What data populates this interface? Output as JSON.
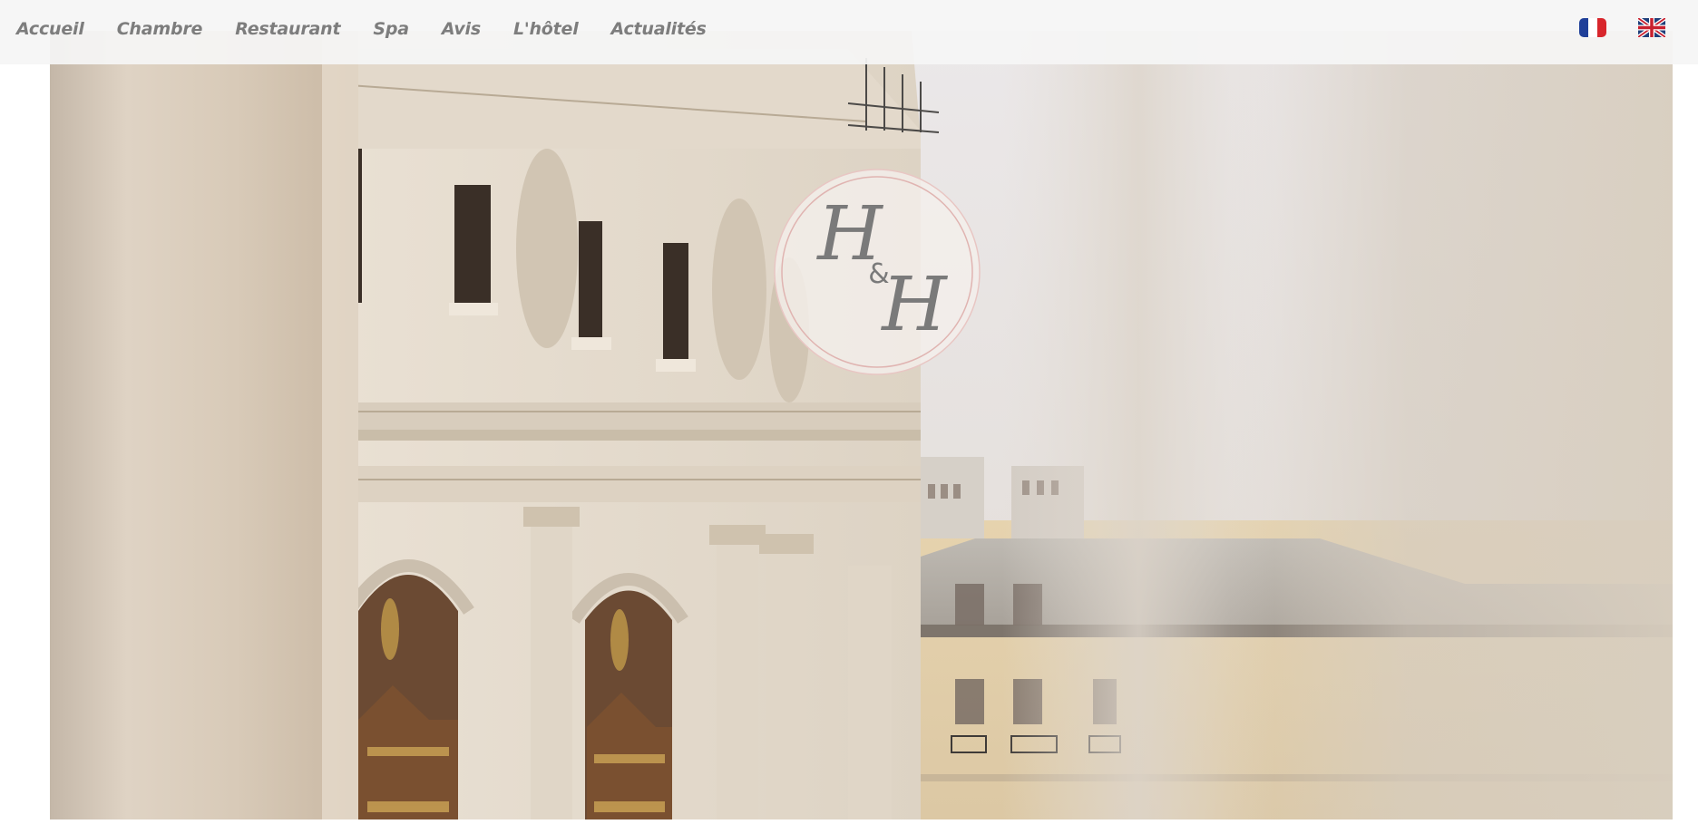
{
  "nav": {
    "items": [
      {
        "label": "Accueil"
      },
      {
        "label": "Chambre"
      },
      {
        "label": "Restaurant"
      },
      {
        "label": "Spa"
      },
      {
        "label": "Avis"
      },
      {
        "label": "L'hôtel"
      },
      {
        "label": "Actualités"
      }
    ],
    "languages": [
      {
        "code": "fr",
        "icon": "france-flag-icon"
      },
      {
        "code": "en",
        "icon": "uk-flag-icon"
      }
    ]
  },
  "logo": {
    "letter_1": "H",
    "ampersand": "&",
    "letter_2": "H"
  },
  "colors": {
    "nav_text": "#7d7d7d",
    "nav_bg": "#f5f5f5",
    "logo_ring": "#e3b9b6",
    "logo_text": "#7a7a7a"
  }
}
